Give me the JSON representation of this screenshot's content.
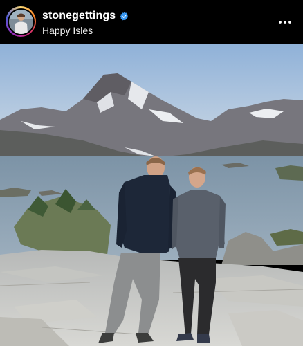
{
  "post": {
    "username": "stonegettings",
    "location": "Happy Isles",
    "verified": true,
    "avatar_icon": "profile-avatar",
    "verified_icon": "verified-badge-icon",
    "more_icon": "more-options-icon"
  },
  "colors": {
    "verified_blue": "#3897f0",
    "background": "#000000"
  }
}
